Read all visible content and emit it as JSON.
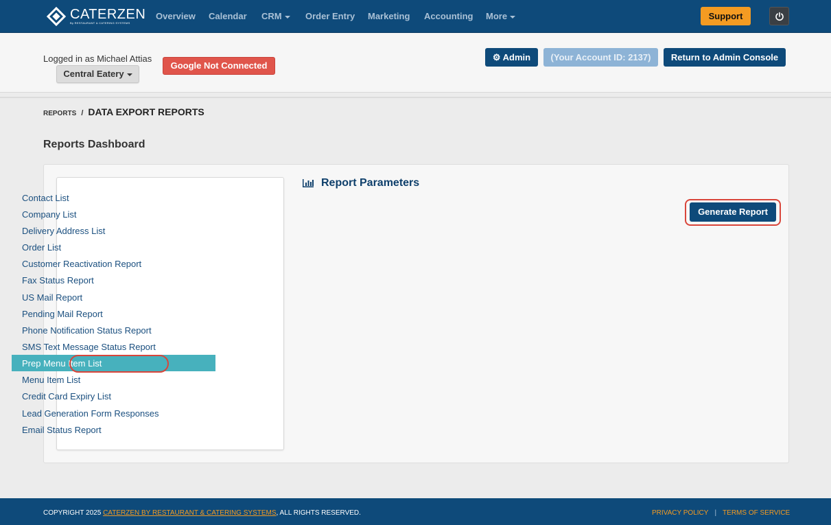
{
  "brand": {
    "name": "CATERZEN",
    "sub": "By RESTAURANT & CATERING SYSTEMS"
  },
  "nav": {
    "items": [
      {
        "label": "Overview"
      },
      {
        "label": "Calendar"
      },
      {
        "label": "CRM"
      },
      {
        "label": "Order Entry"
      },
      {
        "label": "Marketing"
      },
      {
        "label": "Accounting"
      },
      {
        "label": "More"
      }
    ],
    "support_label": "Support"
  },
  "account": {
    "logged_in": "Logged in as Michael Attias",
    "location": "Central Eatery",
    "google_status": "Google Not Connected",
    "admin_label": "Admin",
    "account_id": "(Your Account ID: 2137)",
    "return_label": "Return to Admin Console"
  },
  "breadcrumb": {
    "root": "REPORTS",
    "separator": "/",
    "current": "DATA EXPORT REPORTS"
  },
  "dashboard_title": "Reports Dashboard",
  "reports": {
    "items": [
      {
        "label": "Contact List"
      },
      {
        "label": "Company List"
      },
      {
        "label": "Delivery Address List"
      },
      {
        "label": "Order List"
      },
      {
        "label": "Customer Reactivation Report"
      },
      {
        "label": "Fax Status Report"
      },
      {
        "label": "US Mail Report"
      },
      {
        "label": "Pending Mail Report"
      },
      {
        "label": "Phone Notification Status Report"
      },
      {
        "label": "SMS Text Message Status Report"
      },
      {
        "label": "Prep Menu Item List"
      },
      {
        "label": "Menu Item List"
      },
      {
        "label": "Credit Card Expiry List"
      },
      {
        "label": "Lead Generation Form Responses"
      },
      {
        "label": "Email Status Report"
      }
    ],
    "selected": "Prep Menu Item List"
  },
  "params": {
    "title": "Report Parameters",
    "generate_label": "Generate Report"
  },
  "footer": {
    "copyright_prefix": "COPYRIGHT 2025",
    "copyright_link": "CATERZEN BY RESTAURANT & CATERING SYSTEMS",
    "copyright_suffix": ", ALL RIGHTS RESERVED.",
    "privacy": "PRIVACY POLICY",
    "terms": "TERMS OF SERVICE"
  },
  "colors": {
    "nav_bg": "#0e4a7a",
    "accent_orange": "#f49b22",
    "danger": "#e0554b",
    "selected_teal": "#47b1bd",
    "highlight_ring": "#d9453a"
  }
}
